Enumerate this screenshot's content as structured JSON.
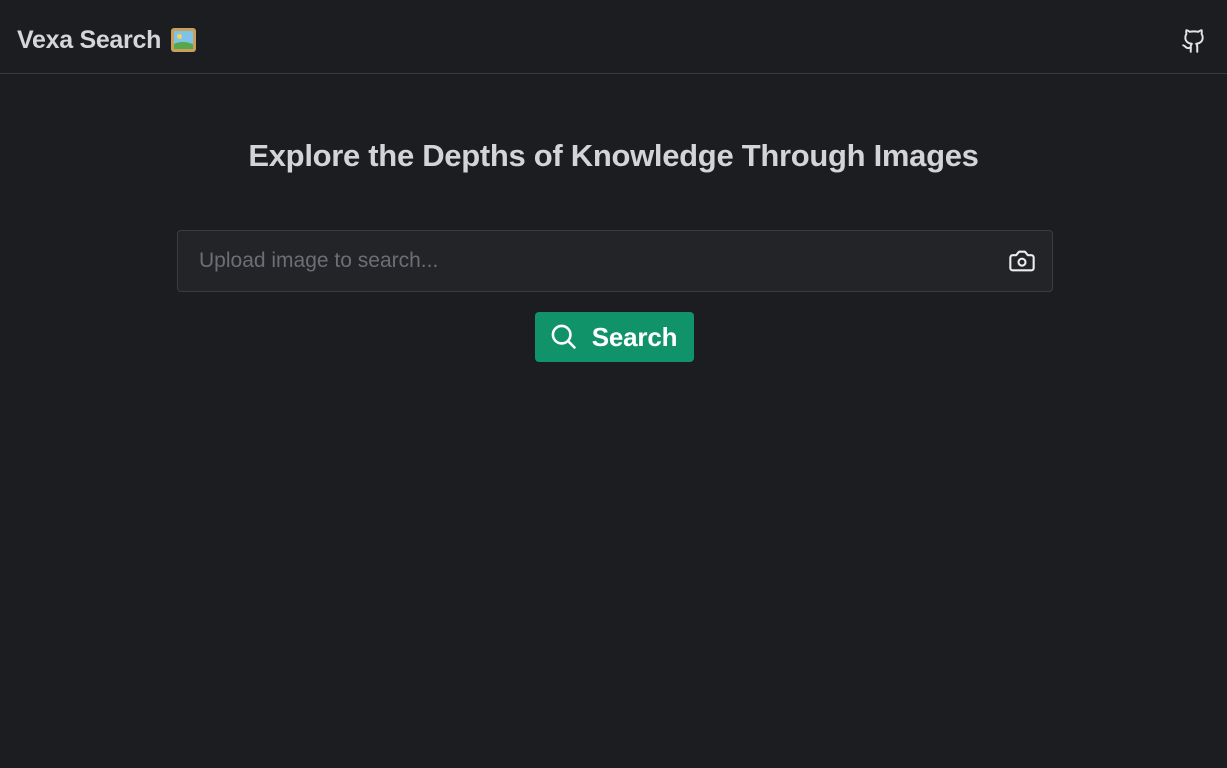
{
  "header": {
    "brand_title": "Vexa Search",
    "brand_emoji_icon": "framed-picture-icon",
    "github_icon": "github-icon"
  },
  "main": {
    "headline": "Explore the Depths of Knowledge Through Images",
    "search": {
      "placeholder": "Upload image to search...",
      "value": "",
      "camera_icon": "camera-icon"
    },
    "search_button": {
      "label": "Search",
      "icon": "search-icon"
    }
  },
  "colors": {
    "background": "#1c1d21",
    "input_background": "#232428",
    "border": "#3b3c42",
    "accent": "#11936a",
    "text": "#d4d4d8",
    "placeholder": "#6d6e74"
  }
}
